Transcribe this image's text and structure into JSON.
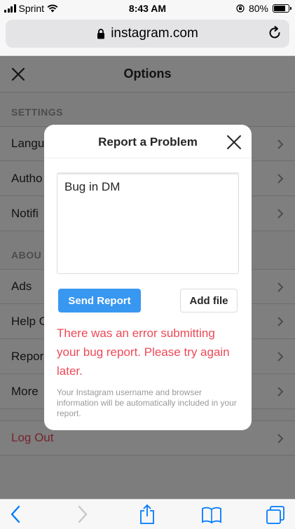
{
  "status_bar": {
    "carrier": "Sprint",
    "time": "8:43 AM",
    "battery_percent": "80%",
    "battery_level": 0.8
  },
  "browser": {
    "url": "instagram.com"
  },
  "options": {
    "title": "Options",
    "settings_label": "SETTINGS",
    "settings_items": [
      "Langu",
      "Autho",
      "Notifi"
    ],
    "about_label": "ABOU",
    "about_items": [
      "Ads",
      "Help C",
      "Repor",
      "More"
    ],
    "logout_label": "Log Out"
  },
  "modal": {
    "title": "Report a Problem",
    "report_text": "Bug in DM",
    "send_label": "Send Report",
    "add_file_label": "Add file",
    "error_message": "There was an error submitting your bug report. Please try again later.",
    "disclaimer": "Your Instagram username and browser information will be automatically included in your report."
  },
  "colors": {
    "accent": "#3897f0",
    "error": "#ed4956",
    "ios_blue": "#007aff"
  }
}
